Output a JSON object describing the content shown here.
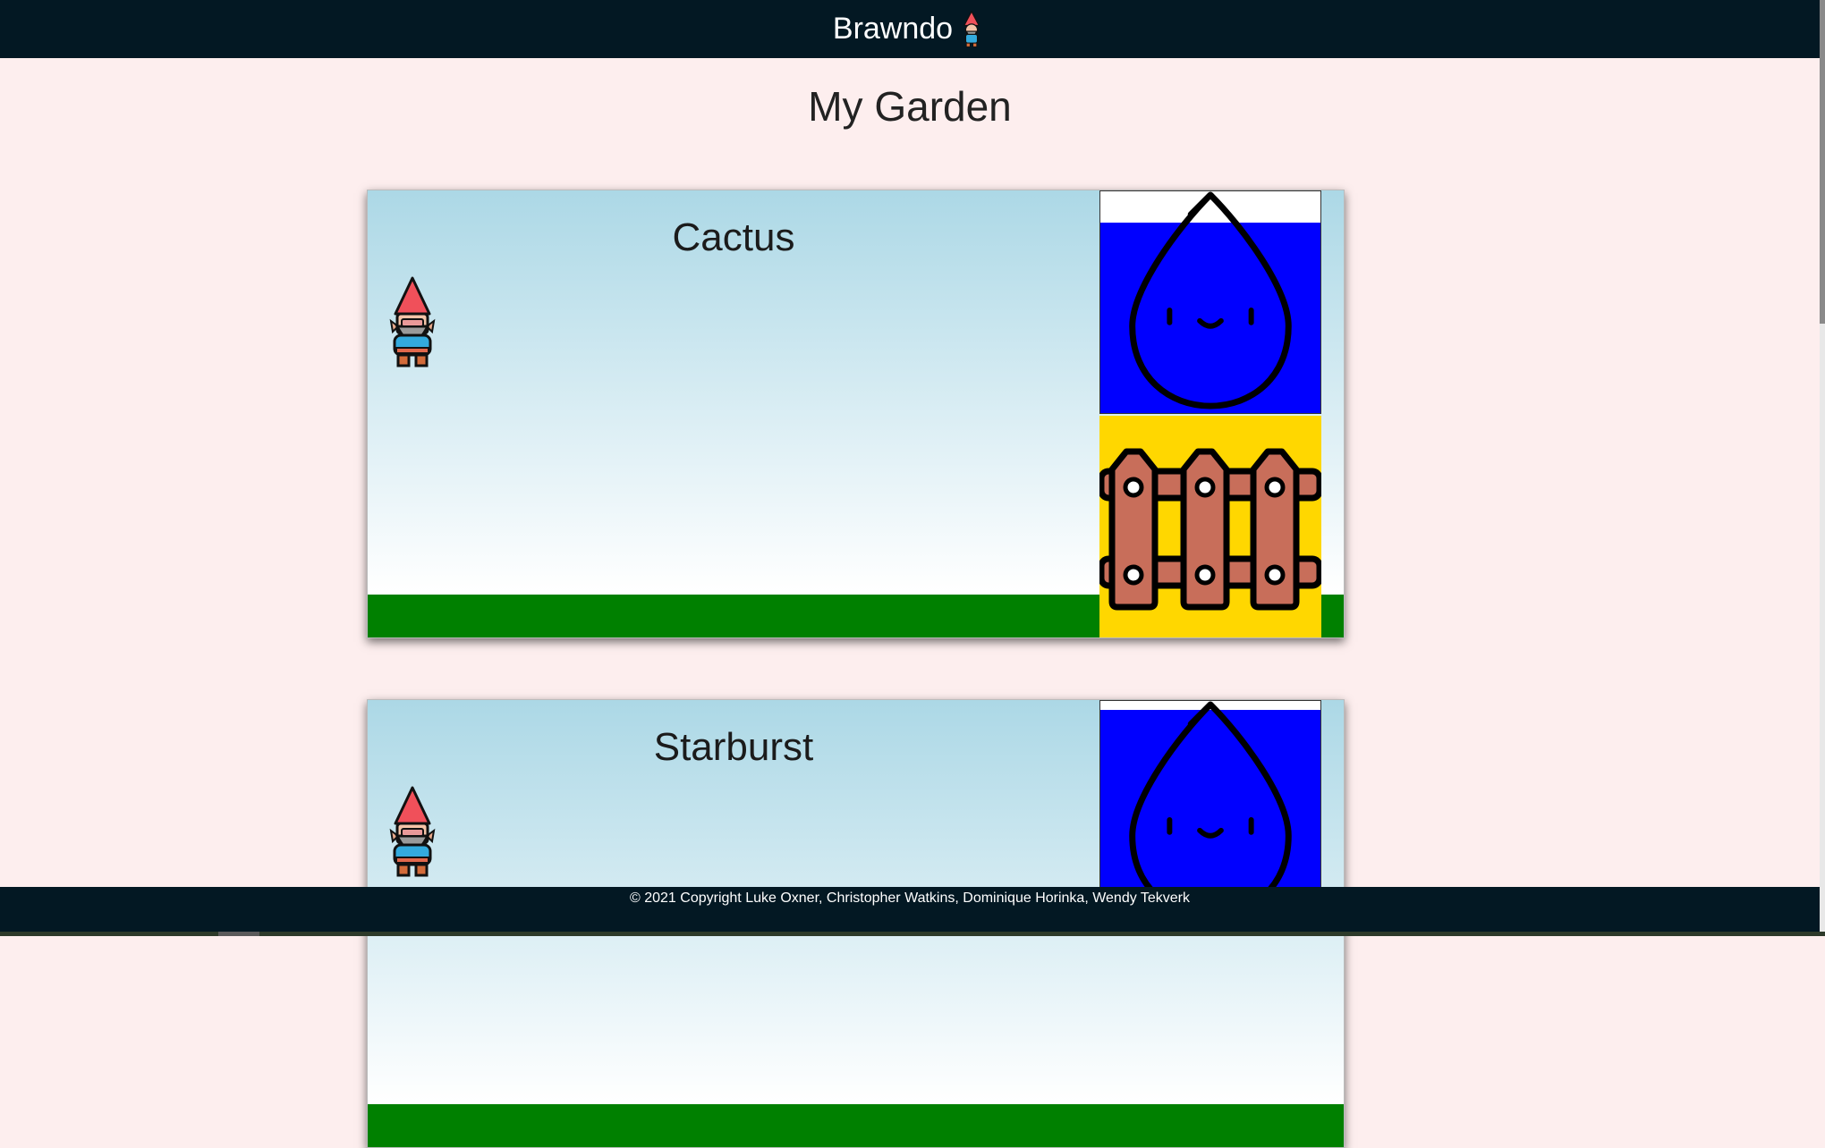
{
  "navbar": {
    "brand": "Brawndo",
    "brand_icon": "gnome-icon"
  },
  "page": {
    "title": "My Garden"
  },
  "plants": [
    {
      "name": "Cactus",
      "water_level": 0.86,
      "fence_visible": true
    },
    {
      "name": "Starburst",
      "water_level": 0.96,
      "fence_visible": false
    }
  ],
  "icons": {
    "avatar": "gnome-icon",
    "water": "water-drop-icon",
    "fence": "fence-icon"
  },
  "colors": {
    "navbar": "#031823",
    "page_background": "#fdeeee",
    "sky": "#acd8e6",
    "grass": "#008000",
    "water": "#0000ff",
    "fence_panel": "#ffd700",
    "fence": "#c86e5a"
  },
  "footer": {
    "copyright": "© 2021 Copyright Luke Oxner, Christopher Watkins, Dominique Horinka, Wendy Tekverk"
  }
}
